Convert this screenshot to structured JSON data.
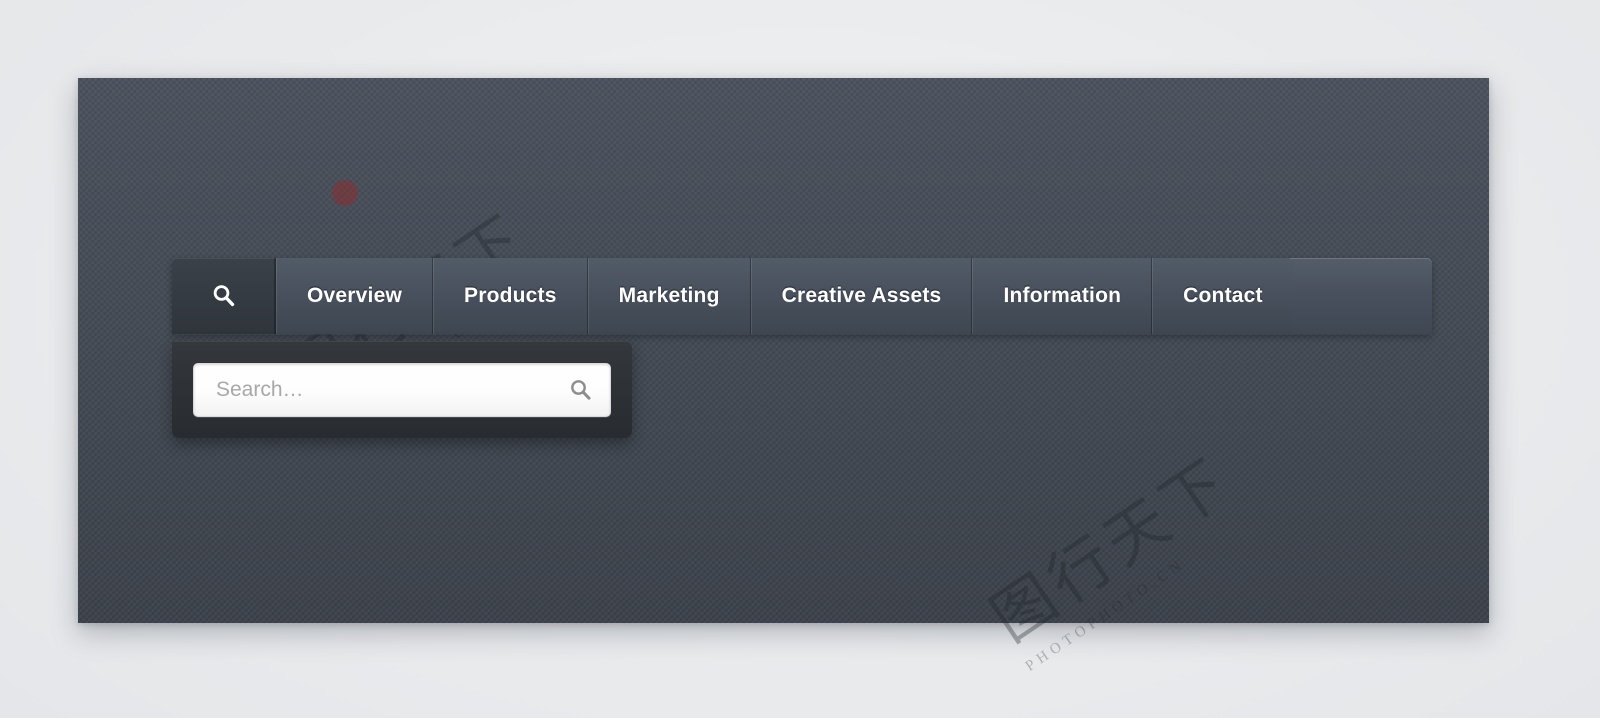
{
  "page": {
    "background_color": "#eaecee",
    "panel_color": "#474e59"
  },
  "navbar": {
    "search_tab": {
      "icon": "search-icon",
      "label": "",
      "state": "active"
    },
    "items": [
      {
        "label": "Overview"
      },
      {
        "label": "Products"
      },
      {
        "label": "Marketing"
      },
      {
        "label": "Creative Assets"
      },
      {
        "label": "Information"
      },
      {
        "label": "Contact"
      }
    ]
  },
  "search_dropdown": {
    "input": {
      "value": "",
      "placeholder": "Search…"
    },
    "submit_icon": "search-icon"
  },
  "watermark": {
    "cjk": "图行天下",
    "latin": "PHOTOPHOTO.CN"
  },
  "colors": {
    "nav_tab_top": "#525b68",
    "nav_tab_bottom": "#3e4651",
    "nav_active_tab": "#353b43",
    "dropdown_bg": "#2d3136",
    "input_bg": "#ffffff",
    "text": "#ffffff",
    "placeholder": "#a8a8a8",
    "icon_gray": "#8a8a8a"
  }
}
